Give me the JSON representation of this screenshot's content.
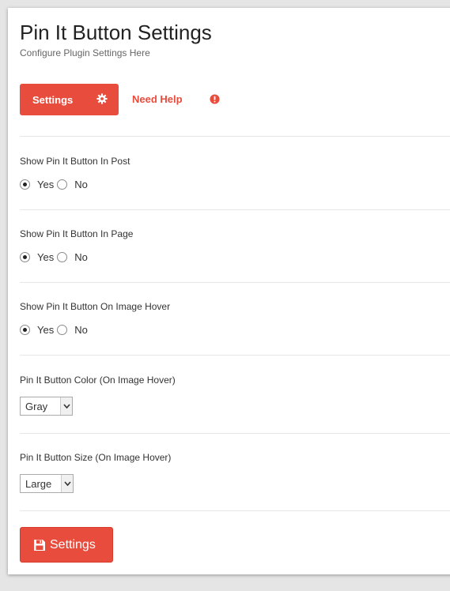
{
  "header": {
    "title": "Pin It Button Settings",
    "subtitle": "Configure Plugin Settings Here"
  },
  "nav": {
    "settings_label": "Settings",
    "settings_icon": "gear-icon",
    "help_label": "Need Help",
    "help_icon": "exclamation-circle-icon"
  },
  "fields": [
    {
      "label": "Show Pin It Button In Post",
      "options": [
        "Yes",
        "No"
      ],
      "selected": "Yes"
    },
    {
      "label": "Show Pin It Button In Page",
      "options": [
        "Yes",
        "No"
      ],
      "selected": "Yes"
    },
    {
      "label": "Show Pin It Button On Image Hover",
      "options": [
        "Yes",
        "No"
      ],
      "selected": "Yes"
    },
    {
      "label": "Pin It Button Color (On Image Hover)",
      "selected_value": "Gray"
    },
    {
      "label": "Pin It Button Size (On Image Hover)",
      "selected_value": "Large"
    }
  ],
  "save": {
    "label": "Settings",
    "icon": "floppy-disk-icon"
  },
  "colors": {
    "accent": "#e74c3c"
  }
}
